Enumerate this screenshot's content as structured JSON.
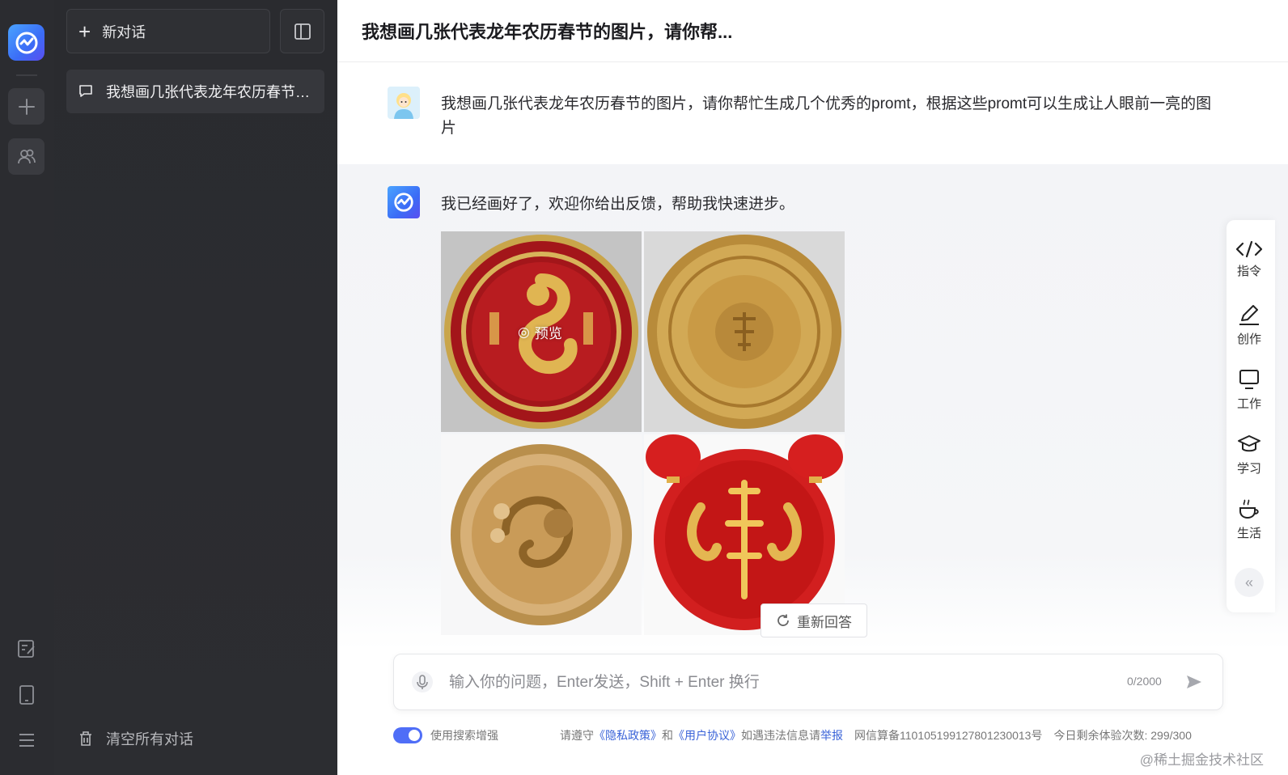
{
  "sidebar": {
    "new_chat_label": "新对话",
    "conversations": [
      {
        "title": "我想画几张代表龙年农历春节的..."
      }
    ],
    "clear_all_label": "清空所有对话"
  },
  "header": {
    "title": "我想画几张代表龙年农历春节的图片，请你帮..."
  },
  "messages": {
    "user_text": "我想画几张代表龙年农历春节的图片，请你帮忙生成几个优秀的promt，根据这些promt可以生成让人眼前一亮的图片",
    "bot_text": "我已经画好了，欢迎你给出反馈，帮助我快速进步。",
    "preview_label": "预览",
    "regenerate_label": "重新回答"
  },
  "input": {
    "placeholder": "输入你的问题，Enter发送，Shift + Enter 换行",
    "value": "",
    "counter": "0/2000"
  },
  "footer": {
    "search_enhance_label": "使用搜索增强",
    "notice_prefix": "请遵守",
    "privacy_link": "《隐私政策》",
    "and_text": "和",
    "terms_link": "《用户协议》",
    "report_prefix": "如遇违法信息请",
    "report_link": "举报",
    "icp": "网信算备110105199127801230013号",
    "quota": "今日剩余体验次数: 299/300"
  },
  "tools": [
    {
      "label": "指令",
      "icon": "code-icon"
    },
    {
      "label": "创作",
      "icon": "pen-icon"
    },
    {
      "label": "工作",
      "icon": "monitor-icon"
    },
    {
      "label": "学习",
      "icon": "graduation-cap-icon"
    },
    {
      "label": "生活",
      "icon": "coffee-cup-icon"
    }
  ],
  "watermark": "@稀土掘金技术社区",
  "colors": {
    "accent": "#4f6ef7",
    "sidebar_bg": "#2b2c30",
    "link": "#3a63d8"
  }
}
